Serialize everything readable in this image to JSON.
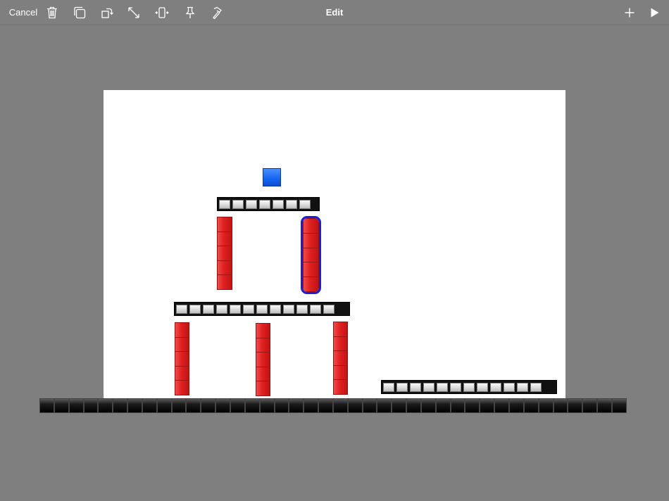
{
  "toolbar": {
    "cancel_label": "Cancel",
    "title": "Edit",
    "icons": [
      "trash-icon",
      "duplicate-icon",
      "rotate-icon",
      "resize-icon",
      "flip-icon",
      "pin-icon",
      "hammer-icon",
      "plus-icon",
      "play-icon"
    ]
  },
  "colors": {
    "background": "#7f7f7f",
    "canvas": "#ffffff",
    "red_block": "#d81e1e",
    "selection": "#1d1ed8",
    "blue_box": "#1464f0",
    "platform": "#111111"
  }
}
